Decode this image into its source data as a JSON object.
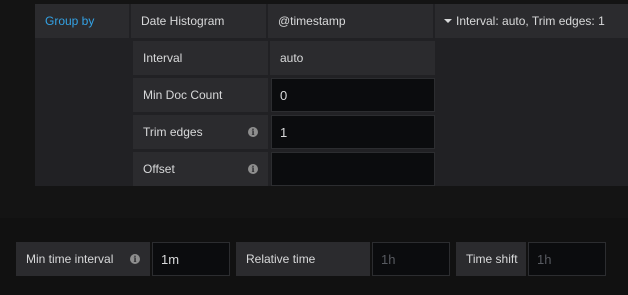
{
  "query": {
    "group_by_label": "Group by",
    "type_label": "Date Histogram",
    "field_label": "@timestamp",
    "summary_label": "Interval: auto, Trim edges: 1",
    "settings": {
      "interval_label": "Interval",
      "interval_value": "auto",
      "min_doc_count_label": "Min Doc Count",
      "min_doc_count_value": "0",
      "trim_edges_label": "Trim edges",
      "trim_edges_value": "1",
      "offset_label": "Offset",
      "offset_value": ""
    }
  },
  "options": {
    "min_time_interval_label": "Min time interval",
    "min_time_interval_value": "1m",
    "relative_time_label": "Relative time",
    "relative_time_placeholder": "1h",
    "time_shift_label": "Time shift",
    "time_shift_placeholder": "1h"
  },
  "icons": {
    "info": "info-icon",
    "caret": "caret-down-icon"
  },
  "colors": {
    "accent_blue": "#33a2e5",
    "panel_bg": "#212124",
    "cell_bg": "#2b2b2e",
    "input_bg": "#0b0c0e"
  }
}
